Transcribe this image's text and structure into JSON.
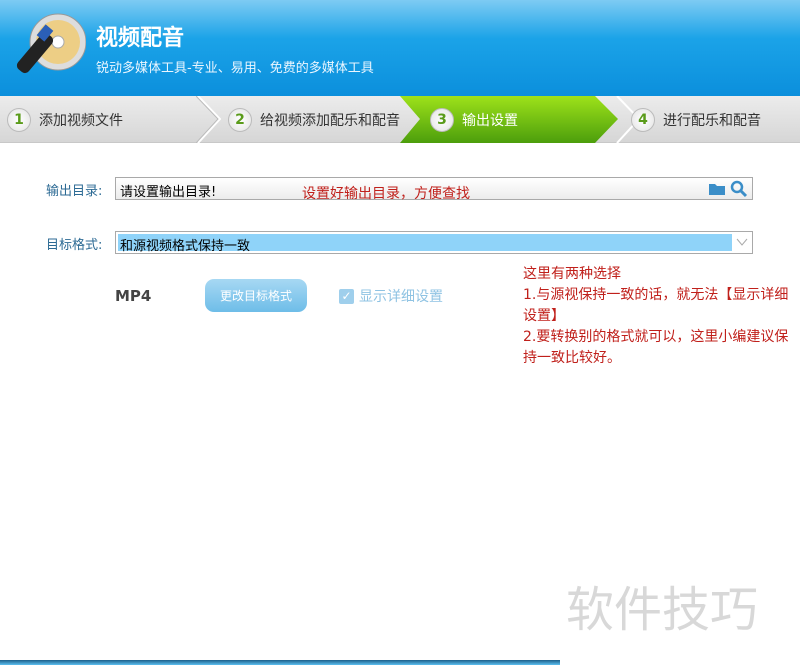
{
  "header": {
    "title": "视频配音",
    "subtitle": "锐动多媒体工具-专业、易用、免费的多媒体工具"
  },
  "steps": [
    {
      "num": "1",
      "label": "添加视频文件"
    },
    {
      "num": "2",
      "label": "给视频添加配乐和配音"
    },
    {
      "num": "3",
      "label": "输出设置",
      "active": true
    },
    {
      "num": "4",
      "label": "进行配乐和配音"
    }
  ],
  "output": {
    "label": "输出目录:",
    "value": "请设置输出目录!",
    "note": "设置好输出目录，方便查找"
  },
  "format": {
    "label": "目标格式:",
    "value": "和源视频格式保持一致",
    "current": "MP4",
    "change_button": "更改目标格式",
    "detail_checkbox": "显示详细设置",
    "detail_checked": true
  },
  "annotation": [
    "这里有两种选择",
    "1.与源视保持一致的话，就无法【显示详细设置】",
    "2.要转换别的格式就可以，这里小编建议保持一致比较好。"
  ],
  "watermark": "软件技巧",
  "colors": {
    "active_step": "#6cc010",
    "header": "#1ba3e8",
    "annotation": "#c0201b"
  }
}
